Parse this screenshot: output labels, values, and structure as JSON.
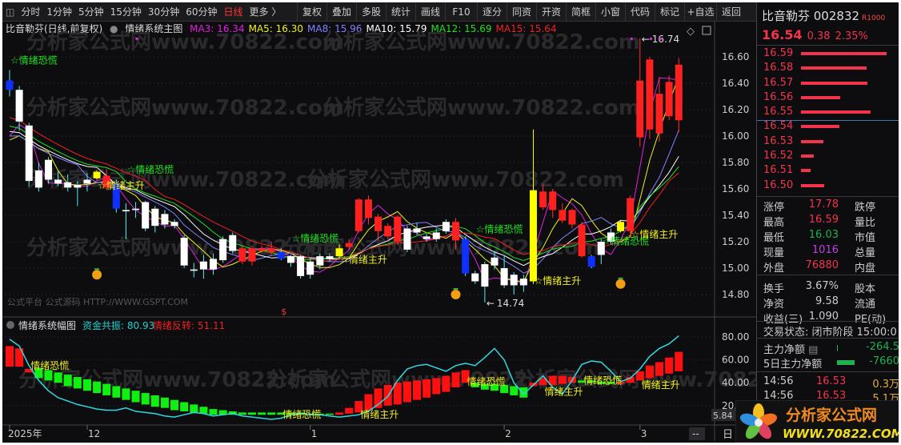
{
  "toolbar": {
    "periods": [
      "分时",
      "1分钟",
      "5分钟",
      "15分钟",
      "30分钟",
      "60分钟",
      "日线",
      "更多 〉"
    ],
    "active_period": "日线",
    "buttons": [
      "复权",
      "叠加",
      "多股",
      "统计",
      "画线",
      "F10",
      "逐分",
      "同资",
      "开资",
      "简框",
      "小窗",
      "代码",
      "标记",
      "+自选",
      "返回"
    ]
  },
  "info": {
    "title": "比音勒芬(日线,前复权)",
    "indicator": "情绪系统主图",
    "ma": [
      {
        "label": "MA3: 16.34",
        "color": "#e020e0",
        "period": 3
      },
      {
        "label": "MA5: 16.30",
        "color": "#f0f020",
        "period": 5
      },
      {
        "label": "MA8: 15.96",
        "color": "#8080ff",
        "period": 8
      },
      {
        "label": "MA10: 15.79",
        "color": "#ffffff",
        "period": 10
      },
      {
        "label": "MA12: 15.69",
        "color": "#20e020",
        "period": 12
      },
      {
        "label": "MA15: 15.64",
        "color": "#f02020",
        "period": 15
      }
    ]
  },
  "watermark": "分析家公式网www.70822.com",
  "source_text": "公式平台 公式源码 HTTP://WWW.GSPT.COM",
  "price_axis": [
    "16.60",
    "16.40",
    "16.20",
    "16.00",
    "15.80",
    "15.60",
    "15.40",
    "15.20",
    "15.00",
    "14.80"
  ],
  "annotations": {
    "high": "16.74",
    "low": "14.74",
    "dollar": "$"
  },
  "signals": [
    {
      "text": "☆情绪恐慌",
      "color": "#20e020",
      "idx": 0,
      "price": 16.55
    },
    {
      "text": "☆情绪恐慌",
      "color": "#20e020",
      "idx": 12,
      "price": 15.72
    },
    {
      "text": "☆情绪主升",
      "color": "#f0f020",
      "idx": 9,
      "price": 15.6
    },
    {
      "text": "☆情绪恐慌",
      "color": "#20e020",
      "idx": 29,
      "price": 15.2
    },
    {
      "text": "☆情绪主升",
      "color": "#f0f020",
      "idx": 34,
      "price": 15.04
    },
    {
      "text": "☆情绪恐慌",
      "color": "#20e020",
      "idx": 48,
      "price": 15.27
    },
    {
      "text": "☆情绪主升",
      "color": "#f0f020",
      "idx": 54,
      "price": 14.88
    },
    {
      "text": "☆情绪恐慌",
      "color": "#20e020",
      "idx": 61,
      "price": 15.18
    },
    {
      "text": "☆情绪主升",
      "color": "#f0f020",
      "idx": 64,
      "price": 15.23
    }
  ],
  "chart_data": [
    {
      "type": "candlestick",
      "title": "情绪系统主图",
      "ylim": [
        14.7,
        16.78
      ],
      "candles": [
        [
          16.42,
          16.35,
          16.5,
          16.3,
          "b"
        ],
        [
          16.35,
          16.11,
          16.38,
          16.04,
          "w"
        ],
        [
          16.08,
          15.66,
          16.1,
          15.62,
          "w"
        ],
        [
          15.74,
          15.61,
          15.8,
          15.58,
          "w"
        ],
        [
          15.82,
          15.67,
          15.84,
          15.64,
          "w"
        ],
        [
          15.67,
          15.64,
          15.73,
          15.62,
          "w"
        ],
        [
          15.65,
          15.61,
          15.71,
          15.58,
          "w"
        ],
        [
          15.63,
          15.61,
          15.66,
          15.47,
          "w"
        ],
        [
          15.67,
          15.64,
          15.72,
          15.58,
          "w"
        ],
        [
          15.73,
          15.68,
          15.74,
          15.67,
          "y"
        ],
        [
          15.7,
          15.61,
          15.75,
          15.59,
          "r"
        ],
        [
          15.64,
          15.45,
          15.67,
          15.42,
          "b"
        ],
        [
          15.44,
          15.43,
          15.49,
          15.22,
          "w"
        ],
        [
          15.45,
          15.44,
          15.5,
          15.38,
          "w"
        ],
        [
          15.5,
          15.3,
          15.51,
          15.28,
          "w"
        ],
        [
          15.45,
          15.32,
          15.47,
          15.27,
          "w"
        ],
        [
          15.41,
          15.33,
          15.44,
          15.3,
          "w"
        ],
        [
          15.35,
          15.32,
          15.37,
          15.3,
          "w"
        ],
        [
          15.23,
          15.02,
          15.25,
          15.0,
          "w"
        ],
        [
          14.99,
          14.98,
          15.04,
          14.93,
          "w"
        ],
        [
          15.05,
          14.99,
          15.1,
          14.92,
          "w"
        ],
        [
          15.07,
          14.99,
          15.11,
          14.95,
          "w"
        ],
        [
          15.22,
          15.06,
          15.24,
          15.04,
          "w"
        ],
        [
          15.25,
          15.13,
          15.27,
          15.11,
          "w"
        ],
        [
          15.15,
          15.05,
          15.17,
          15.03,
          "r"
        ],
        [
          15.15,
          15.05,
          15.16,
          15.02,
          "r"
        ],
        [
          15.15,
          15.13,
          15.17,
          15.12,
          "r"
        ],
        [
          15.15,
          15.12,
          15.2,
          15.1,
          "r"
        ],
        [
          15.12,
          15.07,
          15.15,
          15.06,
          "b"
        ],
        [
          15.09,
          15.04,
          15.1,
          15.01,
          "w"
        ],
        [
          15.09,
          14.94,
          15.1,
          14.92,
          "w"
        ],
        [
          15.05,
          14.95,
          15.08,
          14.92,
          "w"
        ],
        [
          15.09,
          15.02,
          15.11,
          14.99,
          "w"
        ],
        [
          15.09,
          15.07,
          15.11,
          15.05,
          "w"
        ],
        [
          15.15,
          15.09,
          15.18,
          15.07,
          "y"
        ],
        [
          15.19,
          15.16,
          15.22,
          15.14,
          "r"
        ],
        [
          15.52,
          15.28,
          15.53,
          15.27,
          "r"
        ],
        [
          15.52,
          15.38,
          15.55,
          15.33,
          "r"
        ],
        [
          15.39,
          15.28,
          15.41,
          15.21,
          "r"
        ],
        [
          15.32,
          15.24,
          15.34,
          15.22,
          "r"
        ],
        [
          15.39,
          15.2,
          15.4,
          15.18,
          "r"
        ],
        [
          15.3,
          15.14,
          15.32,
          15.12,
          "w"
        ],
        [
          15.3,
          15.27,
          15.34,
          15.25,
          "w"
        ],
        [
          15.24,
          15.22,
          15.26,
          15.2,
          "w"
        ],
        [
          15.27,
          15.22,
          15.3,
          15.2,
          "w"
        ],
        [
          15.35,
          15.28,
          15.37,
          15.26,
          "w"
        ],
        [
          15.35,
          15.21,
          15.38,
          15.14,
          "r"
        ],
        [
          15.22,
          14.96,
          15.24,
          14.94,
          "b"
        ],
        [
          14.96,
          14.9,
          14.98,
          14.88,
          "w"
        ],
        [
          15.03,
          14.86,
          15.05,
          14.74,
          "w"
        ],
        [
          15.08,
          15.02,
          15.13,
          14.99,
          "w"
        ],
        [
          15.0,
          14.87,
          15.1,
          14.85,
          "w"
        ],
        [
          14.95,
          14.87,
          14.97,
          14.8,
          "w"
        ],
        [
          14.92,
          14.87,
          14.95,
          14.82,
          "w"
        ],
        [
          15.59,
          14.9,
          16.05,
          14.88,
          "y"
        ],
        [
          15.58,
          15.46,
          15.64,
          15.44,
          "r"
        ],
        [
          15.58,
          15.44,
          15.6,
          15.38,
          "r"
        ],
        [
          15.44,
          15.36,
          15.49,
          15.34,
          "r"
        ],
        [
          15.44,
          15.33,
          15.45,
          15.3,
          "r"
        ],
        [
          15.33,
          15.09,
          15.35,
          15.08,
          "r"
        ],
        [
          15.09,
          15.01,
          15.1,
          15.0,
          "b"
        ],
        [
          15.2,
          15.1,
          15.22,
          15.03,
          "w"
        ],
        [
          15.27,
          15.2,
          15.3,
          15.18,
          "w"
        ],
        [
          15.35,
          15.28,
          15.36,
          15.27,
          "y"
        ],
        [
          15.53,
          15.28,
          15.55,
          15.26,
          "r"
        ],
        [
          16.42,
          15.99,
          16.74,
          15.92,
          "r"
        ],
        [
          16.58,
          16.05,
          16.6,
          15.98,
          "r"
        ],
        [
          16.32,
          16.02,
          16.45,
          15.96,
          "r"
        ],
        [
          16.41,
          16.15,
          16.46,
          16.12,
          "r"
        ],
        [
          16.54,
          16.12,
          16.59,
          16.03,
          "r"
        ]
      ]
    },
    {
      "type": "bar+line",
      "title": "情绪系统幅图",
      "ylim": [
        5.84,
        84
      ],
      "legend": [
        {
          "label": "资金共振: 80.93",
          "color": "#20d0d0"
        },
        {
          "label": "情绪反转: 51.11",
          "color": "#f02020"
        }
      ],
      "hist": [
        [
          72,
          54,
          "r"
        ],
        [
          70,
          54,
          "r"
        ],
        [
          52,
          49,
          "r"
        ],
        [
          53,
          44,
          "g"
        ],
        [
          51,
          42,
          "g"
        ],
        [
          49,
          40,
          "g"
        ],
        [
          47,
          37,
          "g"
        ],
        [
          45,
          35,
          "g"
        ],
        [
          43,
          33,
          "g"
        ],
        [
          41,
          31,
          "g"
        ],
        [
          39,
          29,
          "g"
        ],
        [
          37,
          27,
          "g"
        ],
        [
          35,
          25,
          "g"
        ],
        [
          33,
          23,
          "g"
        ],
        [
          31,
          21,
          "g"
        ],
        [
          29,
          19,
          "g"
        ],
        [
          27,
          18,
          "g"
        ],
        [
          25,
          16,
          "g"
        ],
        [
          23,
          15,
          "g"
        ],
        [
          21,
          14,
          "g"
        ],
        [
          19,
          13,
          "g"
        ],
        [
          17,
          12,
          "g"
        ],
        [
          16,
          12,
          "g"
        ],
        [
          15,
          12,
          "g"
        ],
        [
          14,
          12,
          "g"
        ],
        [
          14,
          12,
          "g"
        ],
        [
          14,
          12,
          "g"
        ],
        [
          14,
          12,
          "g"
        ],
        [
          14,
          12,
          "g"
        ],
        [
          14,
          12,
          "g"
        ],
        [
          14,
          12,
          "g"
        ],
        [
          13,
          12,
          "g"
        ],
        [
          13,
          12,
          "g"
        ],
        [
          13,
          12,
          "g"
        ],
        [
          14,
          12,
          "r"
        ],
        [
          18,
          13,
          "r"
        ],
        [
          24,
          14,
          "r"
        ],
        [
          30,
          16,
          "r"
        ],
        [
          35,
          18,
          "r"
        ],
        [
          38,
          20,
          "r"
        ],
        [
          40,
          21,
          "r"
        ],
        [
          41,
          23,
          "r"
        ],
        [
          42,
          25,
          "r"
        ],
        [
          43,
          27,
          "r"
        ],
        [
          44,
          30,
          "r"
        ],
        [
          46,
          32,
          "r"
        ],
        [
          49,
          36,
          "r"
        ],
        [
          51,
          40,
          "r"
        ],
        [
          40,
          36,
          "g"
        ],
        [
          39,
          34,
          "g"
        ],
        [
          39,
          33,
          "g"
        ],
        [
          38,
          31,
          "g"
        ],
        [
          37,
          29,
          "g"
        ],
        [
          36,
          27,
          "g"
        ],
        [
          40,
          37,
          "r"
        ],
        [
          44,
          38,
          "r"
        ],
        [
          46,
          38,
          "r"
        ],
        [
          46,
          39,
          "r"
        ],
        [
          45,
          40,
          "r"
        ],
        [
          42,
          40,
          "g"
        ],
        [
          42,
          40,
          "g"
        ],
        [
          41,
          39,
          "g"
        ],
        [
          41,
          39,
          "g"
        ],
        [
          41,
          39,
          "r"
        ],
        [
          45,
          40,
          "r"
        ],
        [
          50,
          42,
          "r"
        ],
        [
          55,
          44,
          "r"
        ],
        [
          58,
          46,
          "r"
        ],
        [
          62,
          48,
          "r"
        ],
        [
          67,
          50,
          "r"
        ]
      ],
      "line": [
        78,
        72,
        55,
        42,
        33,
        27,
        24,
        21,
        19,
        17,
        16,
        16,
        18,
        15,
        14,
        13,
        11,
        10,
        12,
        14,
        13,
        11,
        12,
        13,
        11,
        10,
        9,
        8,
        9,
        12,
        13,
        12,
        12,
        11,
        10,
        11,
        12,
        15,
        21,
        28,
        42,
        52,
        55,
        56,
        53,
        50,
        55,
        57,
        55,
        62,
        70,
        60,
        40,
        30,
        38,
        46,
        36,
        30,
        42,
        56,
        59,
        58,
        50,
        41,
        44,
        52,
        63,
        70,
        74,
        81
      ],
      "labels": [
        {
          "text": "情绪恐慌",
          "idx": 2,
          "v": 55
        },
        {
          "text": "情绪恐慌",
          "idx": 28,
          "v": 12
        },
        {
          "text": "情绪主升",
          "idx": 36,
          "v": 12
        },
        {
          "text": "情绪恐慌",
          "idx": 47,
          "v": 41
        },
        {
          "text": "情绪主升",
          "idx": 55,
          "v": 32
        },
        {
          "text": "情绪恐慌",
          "idx": 59,
          "v": 42
        },
        {
          "text": "情绪主升",
          "idx": 65,
          "v": 38
        }
      ],
      "axis": [
        "80.00",
        "60.00",
        "40.00",
        "20.00"
      ],
      "current": "5.84"
    }
  ],
  "xaxis": [
    {
      "label": "2025年",
      "idx": 0
    },
    {
      "label": "12",
      "idx": 8
    },
    {
      "label": "1",
      "idx": 31
    },
    {
      "label": "2",
      "idx": 51
    },
    {
      "label": "3",
      "idx": 65
    }
  ],
  "xaxis_end": "--",
  "period_char": "日",
  "quote": {
    "name_code": "比音勒芬 002832",
    "badge": "R1000",
    "price": "16.54",
    "change": "0.38",
    "pct": "2.35%",
    "book": [
      {
        "p": "16.59",
        "f": 1.0
      },
      {
        "p": "16.58",
        "f": 0.77
      },
      {
        "p": "16.57",
        "f": 0.78
      },
      {
        "p": "16.56",
        "f": 0.46
      },
      {
        "p": "16.55",
        "f": 0.81
      },
      {
        "p": "16.54",
        "f": 0.45
      },
      {
        "p": "16.53",
        "f": 0.26
      },
      {
        "p": "16.52",
        "f": 0.15
      },
      {
        "p": "16.51",
        "f": 0.11
      },
      {
        "p": "16.50",
        "f": 0.27
      }
    ],
    "stats": [
      {
        "l": "涨停",
        "v": "17.78",
        "c": "#f2344c",
        "l2": "跌停"
      },
      {
        "l": "最高",
        "v": "16.59",
        "c": "#f2344c",
        "l2": "量比"
      },
      {
        "l": "最低",
        "v": "16.03",
        "c": "#20b050",
        "l2": "市值"
      },
      {
        "l": "现量",
        "v": "1016",
        "c": "#c040e0",
        "l2": "总量"
      },
      {
        "l": "外盘",
        "v": "76880",
        "c": "#f2344c",
        "l2": "内盘"
      },
      {
        "l": "换手",
        "v": "3.67%",
        "c": "#ccc",
        "l2": "股本"
      },
      {
        "l": "净资",
        "v": "9.58",
        "c": "#ccc",
        "l2": "流通"
      },
      {
        "l": "收益(三)",
        "v": "1.090",
        "c": "#ccc",
        "l2": "PE(动)"
      }
    ],
    "trade_status": "交易状态: 闭市阶段 15:00:0",
    "main_net": {
      "label": "主力净额",
      "value": "-264.5"
    },
    "main_net5": {
      "label": "5日主力净额",
      "value": "-7660"
    },
    "ticks": [
      {
        "t": "14:56",
        "p": "16.53",
        "v": "0.3万"
      },
      {
        "t": "14:56",
        "p": "16.53",
        "v": "5.1万"
      }
    ]
  },
  "logo": {
    "name": "分析家公式网",
    "url": "WWW.70822.COM"
  }
}
